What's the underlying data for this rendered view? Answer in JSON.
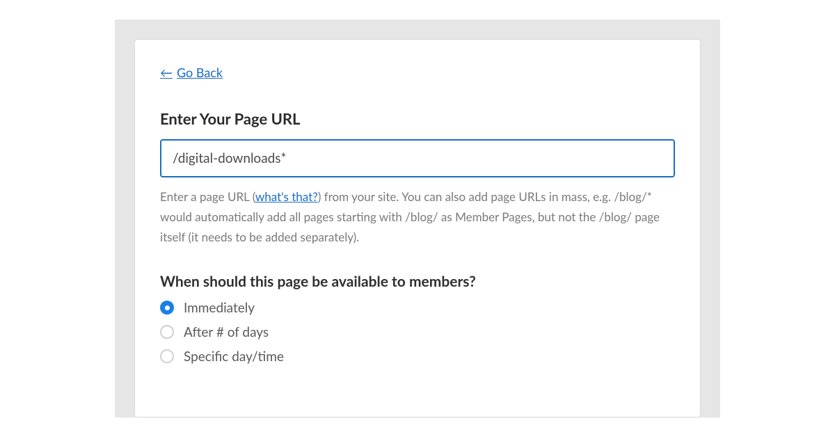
{
  "nav": {
    "go_back_label": "Go Back"
  },
  "url_section": {
    "heading": "Enter Your Page URL",
    "input_value": "/digital-downloads*",
    "help_prefix": "Enter a page URL (",
    "help_link": "what's that?",
    "help_suffix": ") from your site. You can also add page URLs in mass, e.g. /blog/* would automatically add all pages starting with /blog/ as Member Pages, but not the /blog/ page itself (it needs to be added separately)."
  },
  "availability": {
    "heading": "When should this page be available to members?",
    "options": [
      {
        "label": "Immediately",
        "selected": true
      },
      {
        "label": "After # of days",
        "selected": false
      },
      {
        "label": "Specific day/time",
        "selected": false
      }
    ]
  }
}
